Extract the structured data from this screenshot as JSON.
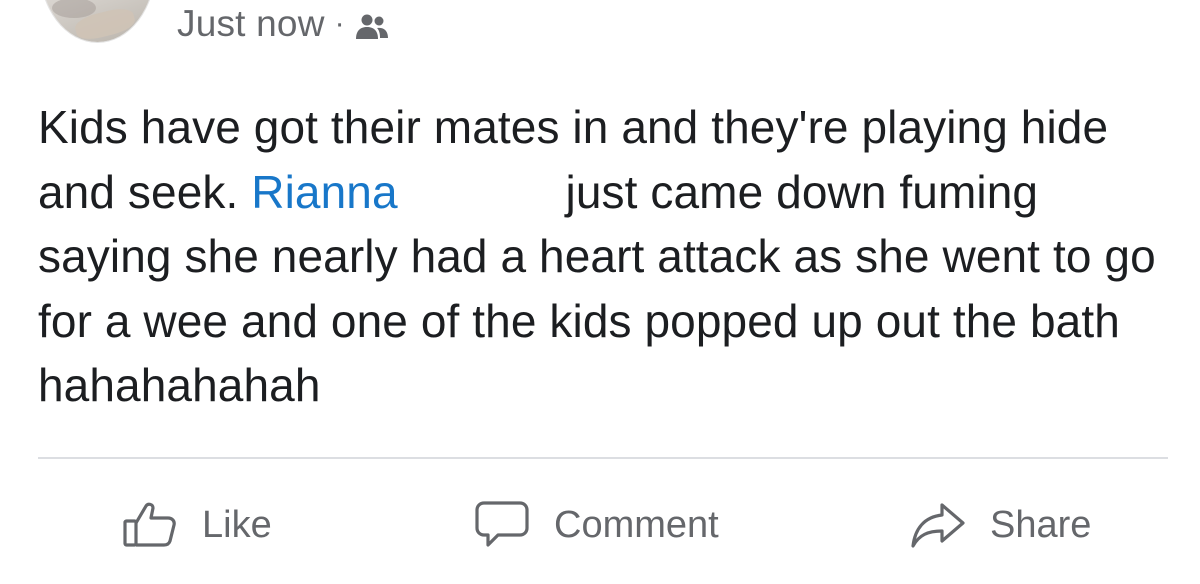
{
  "post": {
    "timestamp": "Just now",
    "separator": "·",
    "audience_icon": "friends-icon",
    "text": {
      "part1": "Kids have got their mates in and they're playing hide and seek. ",
      "mention": "Rianna",
      "part2": " just came down fuming saying she nearly had a heart attack as she went to go for a wee and one of the kids popped up out the bath hahahahahah"
    }
  },
  "actions": {
    "like_label": "Like",
    "comment_label": "Comment",
    "share_label": "Share"
  },
  "colors": {
    "text": "#1c1e21",
    "secondary": "#65676b",
    "mention": "#1877c9",
    "divider": "#dcdee2"
  }
}
